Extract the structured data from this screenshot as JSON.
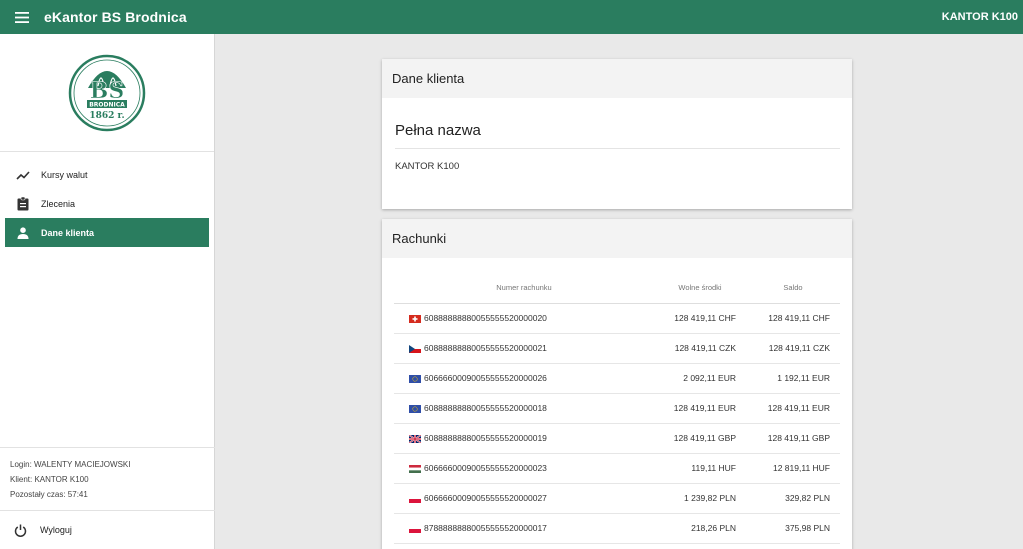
{
  "topbar": {
    "app_title": "eKantor BS Brodnica",
    "kantor_label": "KANTOR K100"
  },
  "logo": {
    "letters": "BS",
    "name": "BRODNICA",
    "year": "1862 r."
  },
  "sidebar": {
    "items": [
      {
        "label": "Kursy walut",
        "icon": "trending-up-icon",
        "active": false
      },
      {
        "label": "Zlecenia",
        "icon": "clipboard-icon",
        "active": false
      },
      {
        "label": "Dane klienta",
        "icon": "person-icon",
        "active": true
      }
    ],
    "login": "Login: WALENTY MACIEJOWSKI",
    "client": "Klient: KANTOR K100",
    "time_left": "Pozostały czas: 57:41",
    "logout_label": "Wyloguj"
  },
  "client_card": {
    "title": "Dane klienta",
    "field_label": "Pełna nazwa",
    "field_value": "KANTOR K100"
  },
  "accounts_card": {
    "title": "Rachunki",
    "columns": [
      "Numer rachunku",
      "Wolne środki",
      "Saldo"
    ],
    "rows": [
      {
        "flag": "CH",
        "number": "60888888880055555520000020",
        "available": "128 419,11 CHF",
        "balance": "128 419,11 CHF"
      },
      {
        "flag": "CZ",
        "number": "60888888880055555520000021",
        "available": "128 419,11 CZK",
        "balance": "128 419,11 CZK"
      },
      {
        "flag": "EU",
        "number": "60666600090055555520000026",
        "available": "2 092,11 EUR",
        "balance": "1 192,11 EUR"
      },
      {
        "flag": "EU",
        "number": "60888888880055555520000018",
        "available": "128 419,11 EUR",
        "balance": "128 419,11 EUR"
      },
      {
        "flag": "GB",
        "number": "60888888880055555520000019",
        "available": "128 419,11 GBP",
        "balance": "128 419,11 GBP"
      },
      {
        "flag": "HU",
        "number": "60666600090055555520000023",
        "available": "119,11 HUF",
        "balance": "12 819,11 HUF"
      },
      {
        "flag": "PL",
        "number": "60666600090055555520000027",
        "available": "1 239,82 PLN",
        "balance": "329,82 PLN"
      },
      {
        "flag": "PL",
        "number": "87888888880055555520000017",
        "available": "218,26 PLN",
        "balance": "375,98 PLN"
      }
    ]
  },
  "colors": {
    "primary": "#2a7d5f",
    "background": "#e9e9e9"
  }
}
